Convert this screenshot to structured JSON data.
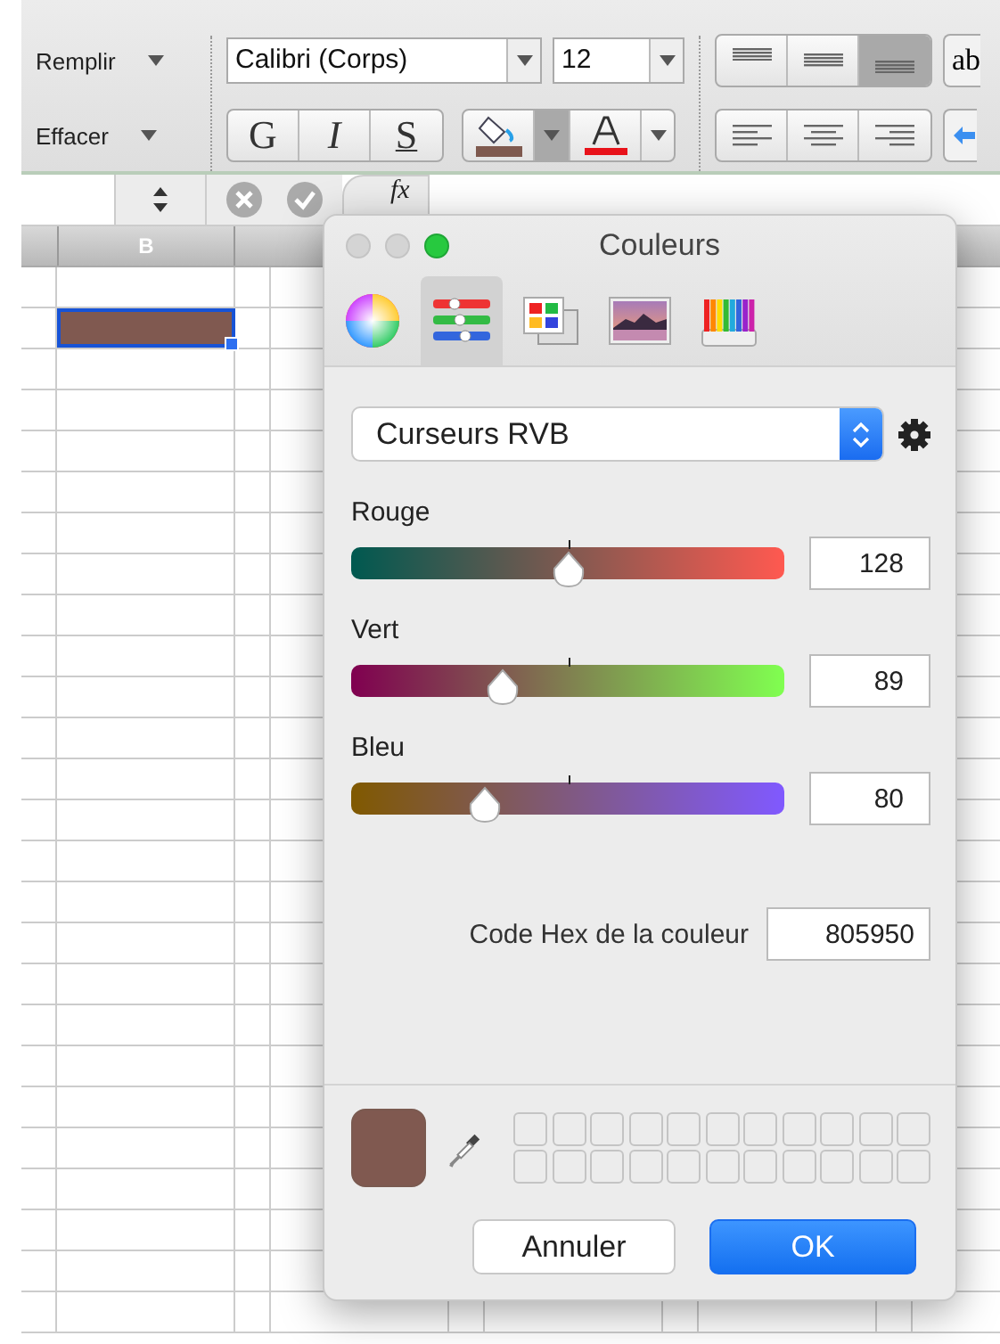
{
  "ribbon": {
    "edit_menus": [
      {
        "label": "Remplir"
      },
      {
        "label": "Effacer"
      }
    ],
    "font_name": "Calibri (Corps)",
    "font_size": "12",
    "style_buttons": [
      {
        "label": "G",
        "kind": "bold"
      },
      {
        "label": "I",
        "kind": "italic"
      },
      {
        "label": "S",
        "kind": "underline"
      }
    ],
    "vertical_align": [
      {
        "selected": false
      },
      {
        "selected": false
      },
      {
        "selected": true
      }
    ],
    "partial_button": "ab"
  },
  "formula_bar": {
    "function_label": "fx"
  },
  "sheet": {
    "column_header": "B"
  },
  "dialog": {
    "title": "Couleurs",
    "tabs": [
      {
        "kind": "wheel",
        "selected": false
      },
      {
        "kind": "sliders",
        "selected": true
      },
      {
        "kind": "palettes",
        "selected": false
      },
      {
        "kind": "image",
        "selected": false
      },
      {
        "kind": "pencils",
        "selected": false
      }
    ],
    "mode": "Curseurs RVB",
    "sliders": [
      {
        "label": "Rouge",
        "level": 0.5,
        "value": "128"
      },
      {
        "label": "Vert",
        "level": 0.35,
        "value": "89"
      },
      {
        "label": "Bleu",
        "level": 0.31,
        "value": "80"
      }
    ],
    "hex_label": "Code Hex de la couleur",
    "hex_value": "805950",
    "buttons": [
      {
        "label": "Annuler",
        "kind": "secondary"
      },
      {
        "label": "OK",
        "kind": "primary"
      }
    ]
  }
}
